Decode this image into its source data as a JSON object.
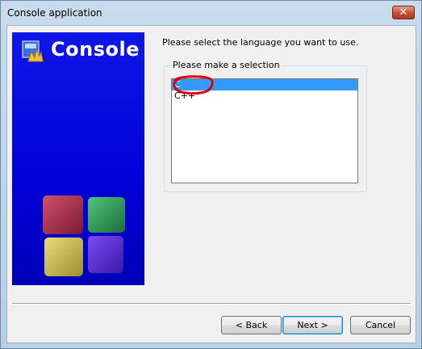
{
  "window": {
    "title": "Console application",
    "close_glyph": "✕"
  },
  "banner": {
    "title": "Console",
    "icon": "codeblocks-icon",
    "background_color": "#0000d8"
  },
  "wizard": {
    "prompt": "Please select the language you want to use.",
    "group_label": "Please make a selection",
    "options": [
      {
        "label": "C",
        "selected": true
      },
      {
        "label": "C++",
        "selected": false
      }
    ],
    "annotation_color": "#e00000"
  },
  "buttons": {
    "back": "< Back",
    "next": "Next >",
    "cancel": "Cancel"
  }
}
